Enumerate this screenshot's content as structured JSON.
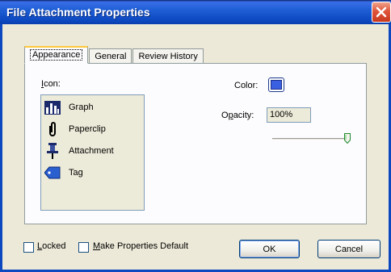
{
  "window": {
    "title": "File Attachment Properties",
    "close_icon": "close-icon"
  },
  "tabs": [
    {
      "label": "Appearance",
      "active": true
    },
    {
      "label": "General",
      "active": false
    },
    {
      "label": "Review History",
      "active": false
    }
  ],
  "appearance": {
    "icon_label": "Icon:",
    "icons": [
      {
        "label": "Graph",
        "icon": "graph-icon"
      },
      {
        "label": "Paperclip",
        "icon": "paperclip-icon"
      },
      {
        "label": "Attachment",
        "icon": "pushpin-icon"
      },
      {
        "label": "Tag",
        "icon": "tag-icon"
      }
    ],
    "color_label": "Color:",
    "color_value": "#3a5fe0",
    "opacity_label": "Opacity:",
    "opacity_value": "100%",
    "opacity_fraction": 1.0
  },
  "footer": {
    "locked_label": "Locked",
    "locked_checked": false,
    "make_default_label": "Make Properties Default",
    "make_default_checked": false,
    "ok_label": "OK",
    "cancel_label": "Cancel"
  }
}
